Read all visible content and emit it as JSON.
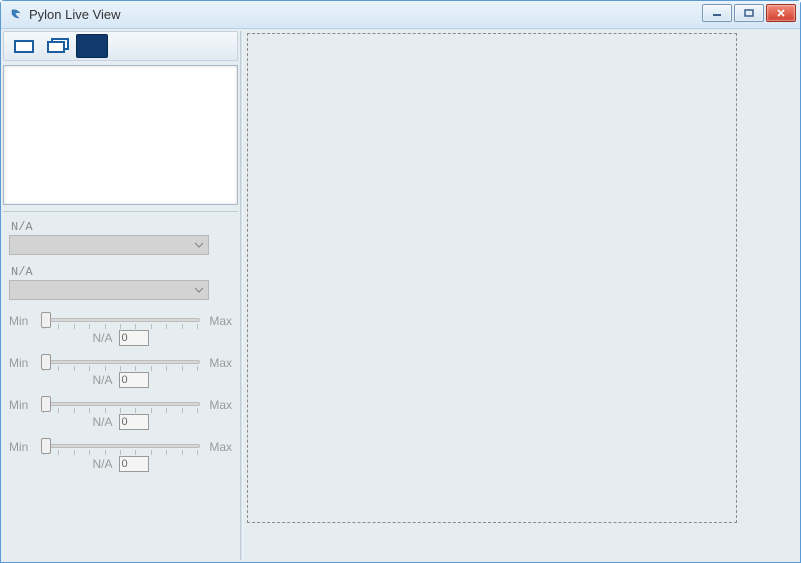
{
  "window": {
    "title": "Pylon Live View"
  },
  "toolbar": {
    "mode_icons": [
      "single-frame",
      "multi-frame",
      "live-solid"
    ]
  },
  "combos": [
    {
      "label": "N/A",
      "value": ""
    },
    {
      "label": "N/A",
      "value": ""
    }
  ],
  "sliders": [
    {
      "min_label": "Min",
      "max_label": "Max",
      "unit_label": "N/A",
      "value": "0"
    },
    {
      "min_label": "Min",
      "max_label": "Max",
      "unit_label": "N/A",
      "value": "0"
    },
    {
      "min_label": "Min",
      "max_label": "Max",
      "unit_label": "N/A",
      "value": "0"
    },
    {
      "min_label": "Min",
      "max_label": "Max",
      "unit_label": "N/A",
      "value": "0"
    }
  ]
}
